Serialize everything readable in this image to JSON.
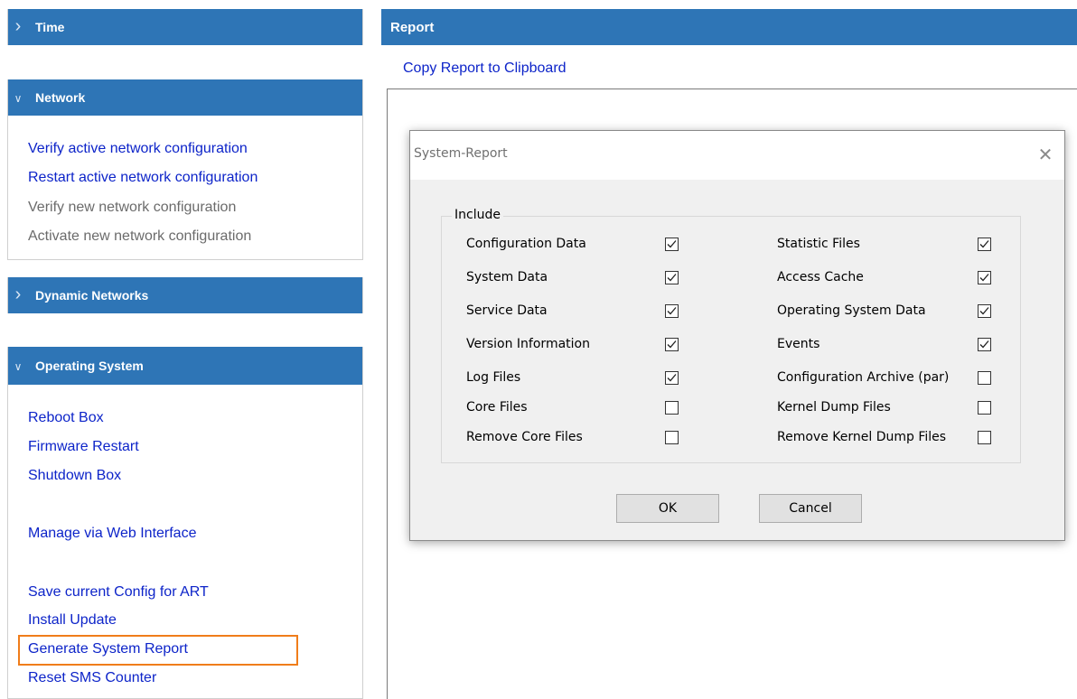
{
  "sidebar": {
    "time": {
      "title": "Time"
    },
    "network": {
      "title": "Network",
      "items": [
        {
          "label": "Verify active network configuration"
        },
        {
          "label": "Restart active network configuration"
        },
        {
          "label": "Verify new network configuration"
        },
        {
          "label": "Activate new network configuration"
        }
      ]
    },
    "dynamic_networks": {
      "title": "Dynamic Networks"
    },
    "operating_system": {
      "title": "Operating System",
      "items": [
        {
          "label": "Reboot Box"
        },
        {
          "label": "Firmware Restart"
        },
        {
          "label": "Shutdown Box"
        },
        {
          "label": "Manage via Web Interface"
        },
        {
          "label": "Save current Config for ART"
        },
        {
          "label": "Install Update"
        },
        {
          "label": "Generate System Report"
        },
        {
          "label": "Reset SMS Counter"
        }
      ]
    }
  },
  "report": {
    "title": "Report",
    "copy_link": "Copy Report to Clipboard"
  },
  "dialog": {
    "title": "System-Report",
    "close_glyph": "✕",
    "group_label": "Include",
    "left_options": [
      {
        "label": "Configuration Data",
        "checked": true
      },
      {
        "label": "System Data",
        "checked": true
      },
      {
        "label": "Service Data",
        "checked": true
      },
      {
        "label": "Version Information",
        "checked": true
      },
      {
        "label": "Log Files",
        "checked": true
      },
      {
        "label": "Core Files",
        "checked": false
      },
      {
        "label": "Remove Core Files",
        "checked": false
      }
    ],
    "right_options": [
      {
        "label": "Statistic Files",
        "checked": true
      },
      {
        "label": "Access Cache",
        "checked": true
      },
      {
        "label": "Operating System Data",
        "checked": true
      },
      {
        "label": "Events",
        "checked": true
      },
      {
        "label": "Configuration Archive (par)",
        "checked": false
      },
      {
        "label": "Kernel Dump Files",
        "checked": false
      },
      {
        "label": "Remove Kernel Dump Files",
        "checked": false
      }
    ],
    "ok_label": "OK",
    "cancel_label": "Cancel"
  },
  "colors": {
    "header_blue": "#2e75b6",
    "link_blue": "#0d24c9",
    "disabled_gray": "#6b6b6b",
    "highlight_orange": "#f07d1a"
  }
}
